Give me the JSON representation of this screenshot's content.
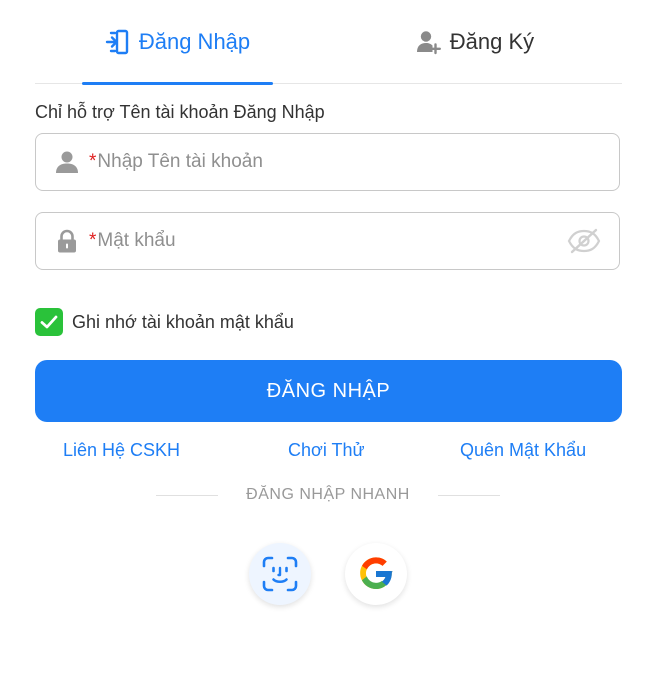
{
  "tabs": {
    "login_label": "Đăng Nhập",
    "register_label": "Đăng Ký"
  },
  "form": {
    "hint": "Chỉ hỗ trợ Tên tài khoản Đăng Nhập",
    "username_placeholder": "Nhập Tên tài khoản",
    "password_placeholder": "Mật khẩu",
    "required_mark": "*",
    "remember_label": "Ghi nhớ tài khoản mật khẩu",
    "remember_checked": true,
    "submit_label": "ĐĂNG NHẬP"
  },
  "links": {
    "support": "Liên Hệ CSKH",
    "try_play": "Chơi Thử",
    "forgot_password": "Quên Mật Khẩu"
  },
  "quick_login": {
    "label": "ĐĂNG NHẬP NHANH",
    "face_icon": "face-id-icon",
    "google_icon": "google-icon"
  },
  "colors": {
    "accent": "#1e7ef5",
    "checkbox": "#2ac23a",
    "required": "#e02020"
  }
}
